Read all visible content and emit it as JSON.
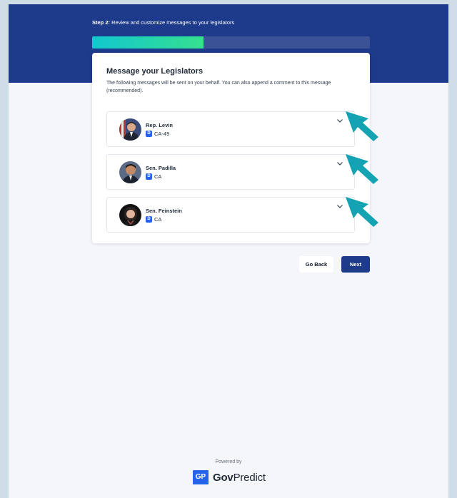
{
  "header": {
    "step_label": "Step 2:",
    "step_text": "Review and customize messages to your legislators",
    "progress_fraction": 0.4
  },
  "card": {
    "title": "Message your Legislators",
    "description": "The following messages will be sent on your behalf. You can also append a comment to this message (recommended)."
  },
  "legislators": [
    {
      "name": "Rep. Levin",
      "party": "D",
      "district": "CA-49"
    },
    {
      "name": "Sen. Padilla",
      "party": "D",
      "district": "CA"
    },
    {
      "name": "Sen. Feinstein",
      "party": "D",
      "district": "CA"
    }
  ],
  "actions": {
    "back_label": "Go Back",
    "next_label": "Next"
  },
  "footer": {
    "powered_by": "Powered by",
    "logo_mark": "GP",
    "logo_text_bold": "Gov",
    "logo_text": "Predict"
  },
  "colors": {
    "header_bg": "#1e3a8a",
    "party_badge": "#2563eb",
    "annotation_arrow": "#14a3b3"
  }
}
